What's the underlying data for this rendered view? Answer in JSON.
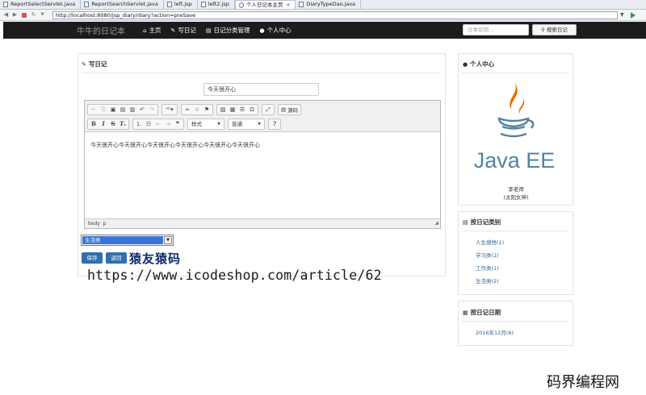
{
  "browser": {
    "tabs": [
      {
        "label": "ReportSelectServlet.java",
        "active": false
      },
      {
        "label": "ReportSearchServlet.java",
        "active": false
      },
      {
        "label": "left.jsp",
        "active": false
      },
      {
        "label": "left2.jsp",
        "active": false
      },
      {
        "label": "个人日记本主页",
        "active": true
      },
      {
        "label": "DiaryTypeDao.java",
        "active": false
      }
    ],
    "url": "http://localhost:8080/jsp_diary/diary?action=preSave"
  },
  "navbar": {
    "brand": "牛牛的日记本",
    "items": [
      {
        "label": "主页",
        "icon": "home-icon"
      },
      {
        "label": "写日记",
        "icon": "pencil-icon"
      },
      {
        "label": "日记分类管理",
        "icon": "book-icon"
      },
      {
        "label": "个人中心",
        "icon": "user-icon"
      }
    ],
    "search_placeholder": "往事如烟...",
    "search_button": "搜索日记"
  },
  "write_panel": {
    "heading": "写日记",
    "title_value": "今天很开心",
    "editor": {
      "source_label": "源码",
      "format_label": "样式",
      "style_label": "普通",
      "content": "今天很开心今天很开心今天很开心今天很开心今天很开心今天很开心",
      "footer_path": "body  p"
    },
    "category_selected": "生活类",
    "save_button": "保存",
    "back_button": "返回"
  },
  "watermark": {
    "cn": "猿友猿码",
    "url": "https://www.icodeshop.com/article/62",
    "site": "码界编程网"
  },
  "sidebar": {
    "profile_heading": "个人中心",
    "logo_text": "Java EE",
    "teacher_name": "李老师",
    "teacher_note": "(太阳女神)",
    "category_heading": "按日记类别",
    "categories": [
      "人生感悟(1)",
      "学习类(2)",
      "工作类(1)",
      "生活类(2)"
    ],
    "date_heading": "按日记日期",
    "dates": [
      "2016年12月(6)"
    ]
  },
  "colors": {
    "navbar_bg": "#1c1c1c",
    "link": "#2a6496",
    "button": "#2f6fb0",
    "java_orange": "#e76f00",
    "java_blue": "#5382a1"
  }
}
